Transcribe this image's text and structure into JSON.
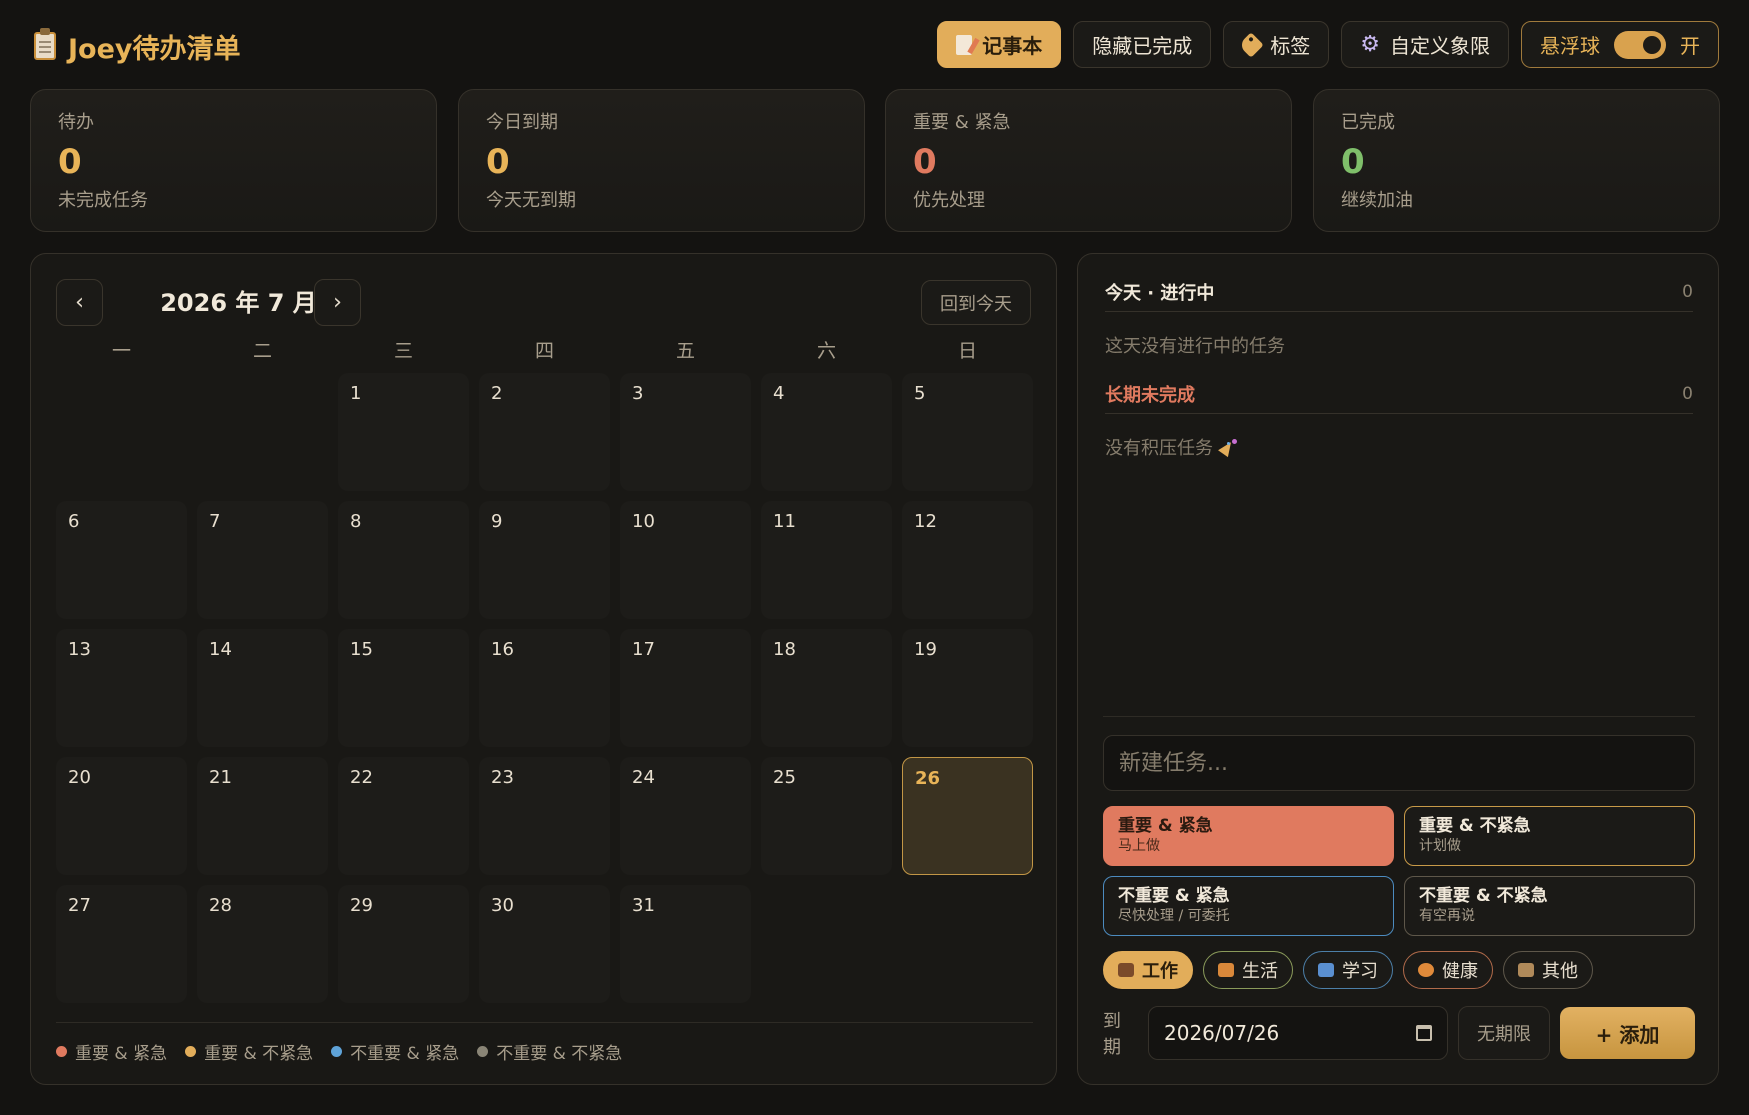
{
  "header": {
    "title": "Joey待办清单",
    "buttons": {
      "notebook": "记事本",
      "hide_done": "隐藏已完成",
      "tags": "标签",
      "custom_quadrant": "自定义象限",
      "float_ball": "悬浮球",
      "float_state": "开"
    }
  },
  "stats": [
    {
      "label": "待办",
      "value": "0",
      "sub": "未完成任务",
      "color": "#e8b458"
    },
    {
      "label": "今日到期",
      "value": "0",
      "sub": "今天无到期",
      "color": "#e8b458"
    },
    {
      "label": "重要 & 紧急",
      "value": "0",
      "sub": "优先处理",
      "color": "#e07a5f"
    },
    {
      "label": "已完成",
      "value": "0",
      "sub": "继续加油",
      "color": "#7fbf6a"
    }
  ],
  "calendar": {
    "month_title": "2026 年 7 月",
    "prev": "‹",
    "next": "›",
    "today_button": "回到今天",
    "weekdays": [
      "一",
      "二",
      "三",
      "四",
      "五",
      "六",
      "日"
    ],
    "leading_blanks": 2,
    "days": [
      "1",
      "2",
      "3",
      "4",
      "5",
      "6",
      "7",
      "8",
      "9",
      "10",
      "11",
      "12",
      "13",
      "14",
      "15",
      "16",
      "17",
      "18",
      "19",
      "20",
      "21",
      "22",
      "23",
      "24",
      "25",
      "26",
      "27",
      "28",
      "29",
      "30",
      "31"
    ],
    "today": "26",
    "legend": [
      {
        "label": "重要 & 紧急",
        "color": "#e07a5f"
      },
      {
        "label": "重要 & 不紧急",
        "color": "#e2ad5a"
      },
      {
        "label": "不重要 & 紧急",
        "color": "#5fa3d8"
      },
      {
        "label": "不重要 & 不紧急",
        "color": "#8a8576"
      }
    ]
  },
  "tasks": {
    "today_title": "今天 · 进行中",
    "today_count": "0",
    "today_empty": "这天没有进行中的任务",
    "backlog_title": "长期未完成",
    "backlog_count": "0",
    "backlog_empty": "没有积压任务",
    "input_placeholder": "新建任务...",
    "quadrants": [
      {
        "title": "重要 & 紧急",
        "sub": "马上做"
      },
      {
        "title": "重要 & 不紧急",
        "sub": "计划做"
      },
      {
        "title": "不重要 & 紧急",
        "sub": "尽快处理 / 可委托"
      },
      {
        "title": "不重要 & 不紧急",
        "sub": "有空再说"
      }
    ],
    "categories": [
      "工作",
      "生活",
      "学习",
      "健康",
      "其他"
    ],
    "due_label": "到期",
    "due_date": "2026/07/26",
    "no_limit": "无期限",
    "add_button": "+ 添加"
  }
}
